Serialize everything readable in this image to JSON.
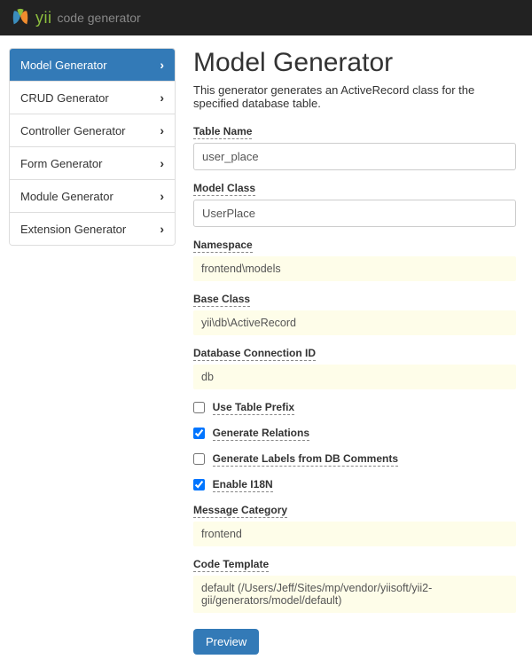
{
  "brand": {
    "yii": "yii",
    "sub": "code generator"
  },
  "sidebar": {
    "items": [
      {
        "label": "Model Generator"
      },
      {
        "label": "CRUD Generator"
      },
      {
        "label": "Controller Generator"
      },
      {
        "label": "Form Generator"
      },
      {
        "label": "Module Generator"
      },
      {
        "label": "Extension Generator"
      }
    ]
  },
  "main": {
    "title": "Model Generator",
    "description": "This generator generates an ActiveRecord class for the specified database table.",
    "fields": {
      "table_name": {
        "label": "Table Name",
        "value": "user_place"
      },
      "model_class": {
        "label": "Model Class",
        "value": "UserPlace"
      },
      "namespace": {
        "label": "Namespace",
        "value": "frontend\\models"
      },
      "base_class": {
        "label": "Base Class",
        "value": "yii\\db\\ActiveRecord"
      },
      "db_connection": {
        "label": "Database Connection ID",
        "value": "db"
      },
      "use_table_prefix": {
        "label": "Use Table Prefix"
      },
      "generate_relations": {
        "label": "Generate Relations"
      },
      "generate_labels": {
        "label": "Generate Labels from DB Comments"
      },
      "enable_i18n": {
        "label": "Enable I18N"
      },
      "message_category": {
        "label": "Message Category",
        "value": "frontend"
      },
      "code_template": {
        "label": "Code Template",
        "value": "default (/Users/Jeff/Sites/mp/vendor/yiisoft/yii2-gii/generators/model/default)"
      }
    },
    "preview_button": "Preview"
  }
}
